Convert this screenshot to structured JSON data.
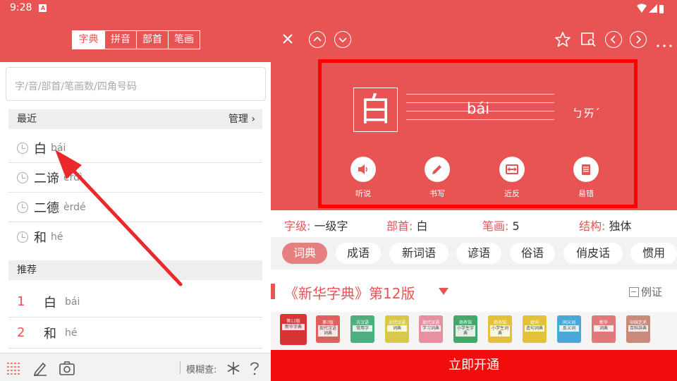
{
  "status": {
    "time": "9:28"
  },
  "left": {
    "segments": [
      "字典",
      "拼音",
      "部首",
      "笔画"
    ],
    "search_placeholder": "字/音/部首/笔画数/四角号码",
    "recent_label": "最近",
    "manage_label": "管理 ›",
    "history": [
      {
        "hz": "白",
        "py": "bái"
      },
      {
        "hz": "二谛",
        "py": "èrdì"
      },
      {
        "hz": "二德",
        "py": "èrdé"
      },
      {
        "hz": "和",
        "py": "hé"
      }
    ],
    "recommend_label": "推荐",
    "recommend": [
      {
        "num": "1",
        "hz": "白",
        "py": "bái"
      },
      {
        "num": "2",
        "hz": "和",
        "py": "hé"
      }
    ],
    "fuzzy_label": "模糊查:"
  },
  "right": {
    "character": "白",
    "pinyin": "bái",
    "zhuyin": "ㄅㄞˊ",
    "actions": [
      {
        "label": "听说",
        "icon": "speaker-icon"
      },
      {
        "label": "书写",
        "icon": "pencil-icon"
      },
      {
        "label": "近反",
        "icon": "swap-icon"
      },
      {
        "label": "易错",
        "icon": "notepad-icon"
      }
    ],
    "props": [
      {
        "k": "字级:",
        "v": "一级字"
      },
      {
        "k": "部首:",
        "v": "白"
      },
      {
        "k": "笔画:",
        "v": "5"
      },
      {
        "k": "结构:",
        "v": "独体"
      }
    ],
    "tags": [
      "词典",
      "成语",
      "新词语",
      "谚语",
      "俗语",
      "俏皮话",
      "惯用"
    ],
    "dict_title": "《新华字典》第12版",
    "example_label": "例证",
    "books": [
      {
        "top": "第12版",
        "title": "新华字典",
        "color": "#d93434"
      },
      {
        "top": "第7版",
        "title": "现代汉语词典",
        "color": "#e06060"
      },
      {
        "top": "古汉语",
        "title": "常用字",
        "color": "#4caf7d"
      },
      {
        "top": "古代汉语",
        "title": "词典",
        "color": "#d9c84a"
      },
      {
        "top": "现代汉语",
        "title": "学习词典",
        "color": "#e88fa0"
      },
      {
        "top": "商务馆",
        "title": "小学生字典",
        "color": "#43a86a"
      },
      {
        "top": "商务馆",
        "title": "小学生词典",
        "color": "#e3c23a"
      },
      {
        "top": "组词",
        "title": "造句词典",
        "color": "#e3c23a"
      },
      {
        "top": "同义词",
        "title": "反义词",
        "color": "#4aa8d8"
      },
      {
        "top": "新华",
        "title": "词典",
        "color": "#e07a7a"
      },
      {
        "top": "中国艺术",
        "title": "百科辞典",
        "color": "#c98a7a"
      }
    ],
    "open_label": "立即开通"
  }
}
